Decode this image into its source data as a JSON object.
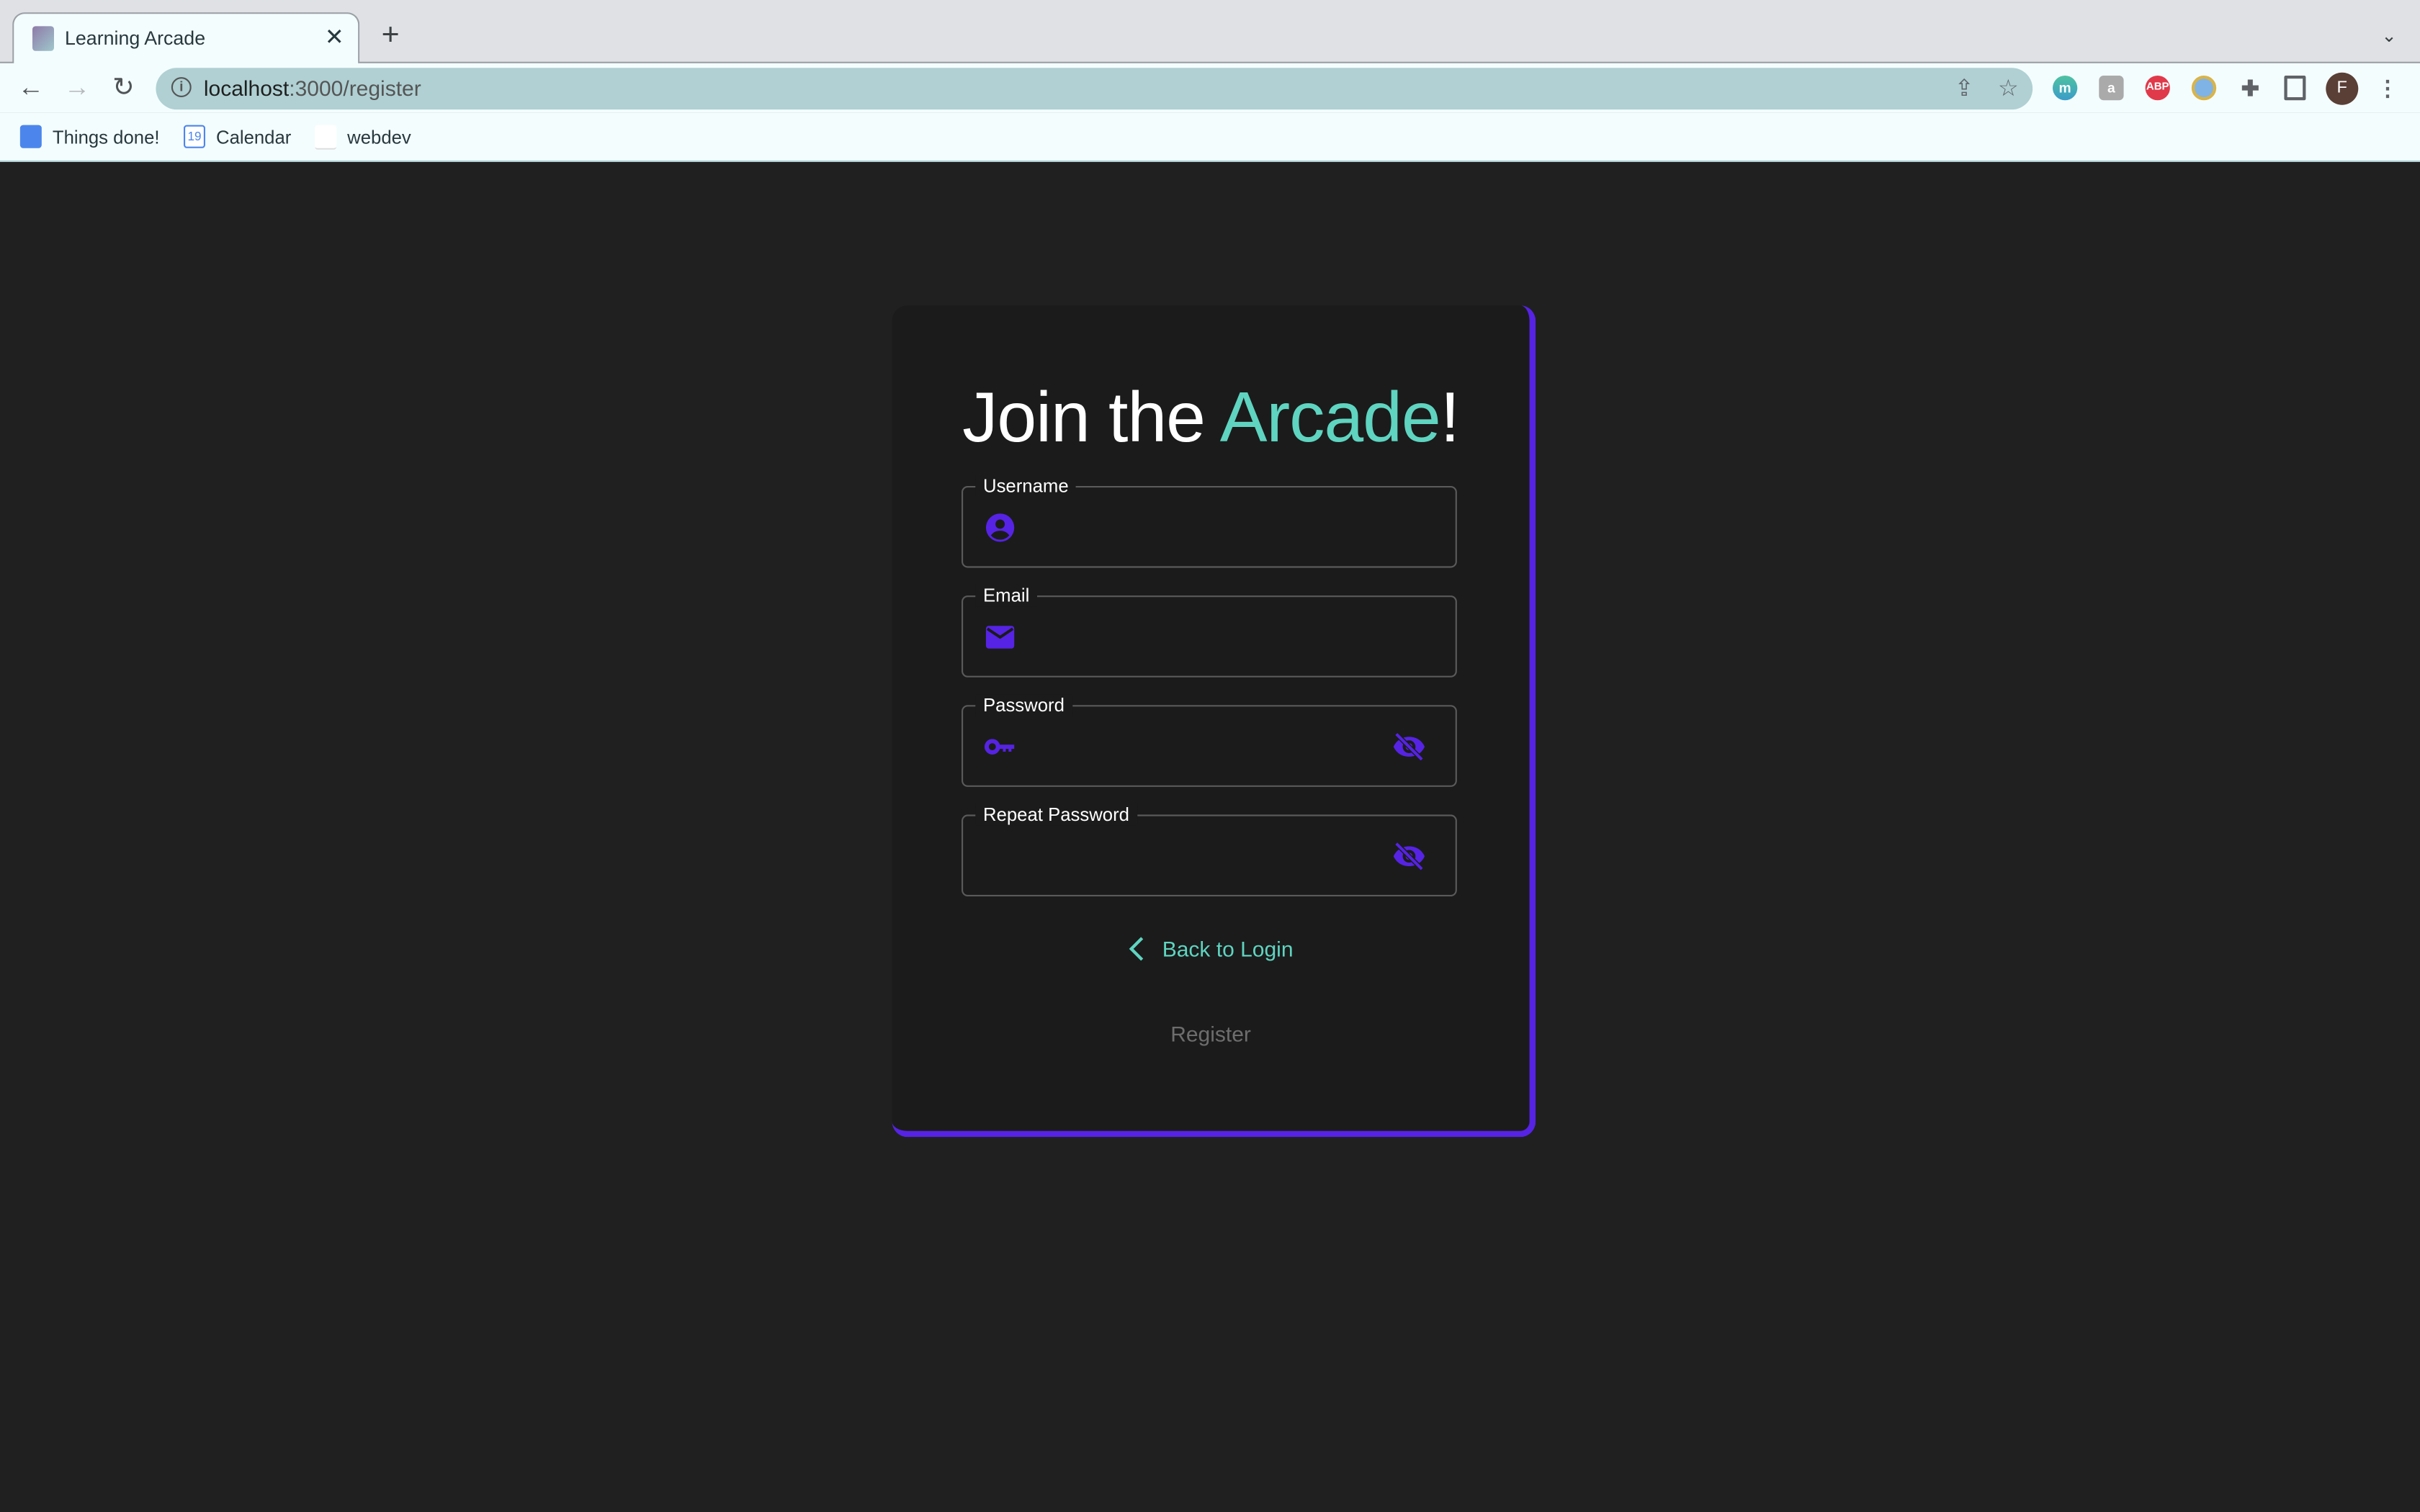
{
  "browser": {
    "tab_title": "Learning Arcade",
    "url_host": "localhost",
    "url_path": ":3000/register",
    "profile_initial": "F",
    "extensions": [
      "m",
      "a",
      "ABP"
    ],
    "bookmarks": [
      {
        "label": "Things done!"
      },
      {
        "label": "Calendar",
        "icon_text": "19"
      },
      {
        "label": "webdev"
      }
    ]
  },
  "form": {
    "title_prefix": "Join the ",
    "title_accent": "Arcade",
    "title_suffix": "!",
    "username_label": "Username",
    "email_label": "Email",
    "password_label": "Password",
    "repeat_password_label": "Repeat Password",
    "back_label": "Back to Login",
    "register_label": "Register"
  },
  "colors": {
    "accent": "#5fd4c0",
    "primary": "#5623e4",
    "background": "#202020",
    "card": "#1b1b1b"
  }
}
